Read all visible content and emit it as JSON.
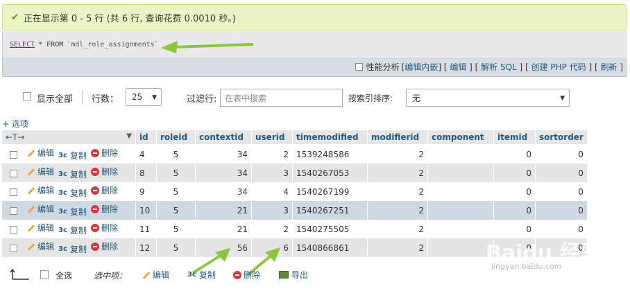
{
  "status": {
    "message": "正在显示第 0 - 5 行 (共 6 行, 查询花费 0.0010 秒。)"
  },
  "sql": {
    "keyword": "SELECT",
    "rest": "* FROM",
    "table": "`mdl_role_assignments`"
  },
  "toolbar": {
    "profiling": "性能分析",
    "links": [
      "编辑内嵌",
      "编辑",
      "解析 SQL",
      "创建 PHP 代码",
      "刷新"
    ]
  },
  "controls": {
    "show_all": "显示全部",
    "rows_label": "行数：",
    "rows_value": "25",
    "filter_label": "过滤行:",
    "filter_placeholder": "在表中搜索",
    "sort_label": "按索引排序:",
    "sort_value": "无"
  },
  "options_link": "+ 选项",
  "columns": [
    "id",
    "roleid",
    "contextid",
    "userid",
    "timemodified",
    "modifierid",
    "component",
    "itemid",
    "sortorder"
  ],
  "actions": {
    "edit": "编辑",
    "copy": "复制",
    "delete": "删除"
  },
  "rows": [
    {
      "id": "4",
      "roleid": "5",
      "contextid": "34",
      "userid": "2",
      "timemodified": "1539248586",
      "modifierid": "2",
      "component": "",
      "itemid": "0",
      "sortorder": "0"
    },
    {
      "id": "8",
      "roleid": "5",
      "contextid": "34",
      "userid": "3",
      "timemodified": "1540267053",
      "modifierid": "2",
      "component": "",
      "itemid": "0",
      "sortorder": "0"
    },
    {
      "id": "9",
      "roleid": "5",
      "contextid": "34",
      "userid": "4",
      "timemodified": "1540267199",
      "modifierid": "2",
      "component": "",
      "itemid": "0",
      "sortorder": "0"
    },
    {
      "id": "10",
      "roleid": "5",
      "contextid": "21",
      "userid": "3",
      "timemodified": "1540267251",
      "modifierid": "2",
      "component": "",
      "itemid": "0",
      "sortorder": "0"
    },
    {
      "id": "11",
      "roleid": "5",
      "contextid": "21",
      "userid": "2",
      "timemodified": "1540275505",
      "modifierid": "2",
      "component": "",
      "itemid": "0",
      "sortorder": "0"
    },
    {
      "id": "12",
      "roleid": "5",
      "contextid": "56",
      "userid": "6",
      "timemodified": "1540866861",
      "modifierid": "2",
      "component": "",
      "itemid": "0",
      "sortorder": "0"
    }
  ],
  "bottom": {
    "select_all": "全选",
    "selected_label": "选中项：",
    "edit": "编辑",
    "copy": "复制",
    "delete": "删除",
    "export": "导出"
  },
  "watermark": {
    "brand": "Baidu 经验",
    "url": "jingyan.baidu.com"
  },
  "colors": {
    "success_bg": "#ebf5c3",
    "link": "#235a81",
    "arrow": "#8cc63f",
    "highlight_row": "#cfd9e3"
  }
}
